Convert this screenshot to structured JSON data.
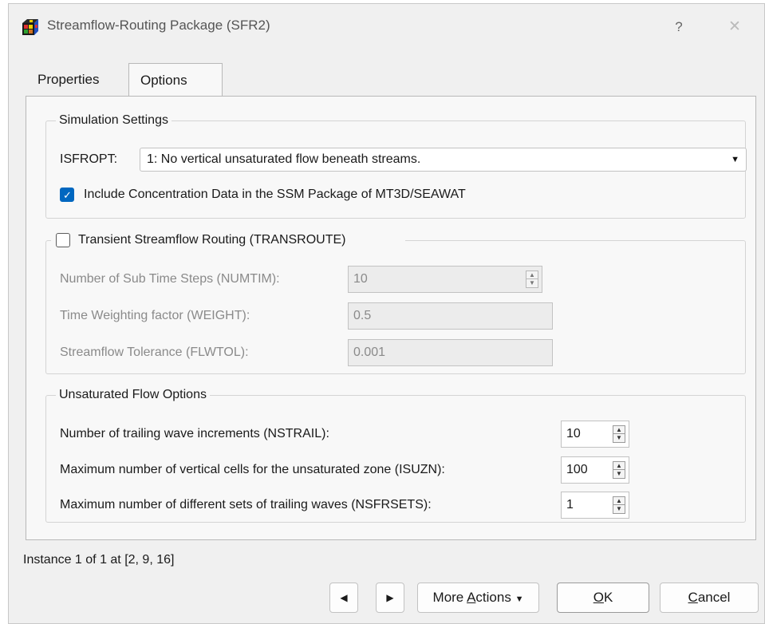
{
  "window": {
    "title": "Streamflow-Routing Package (SFR2)",
    "help_glyph": "?",
    "close_glyph": "✕"
  },
  "tabs": [
    {
      "label": "Properties",
      "active": false
    },
    {
      "label": "Options",
      "active": true
    }
  ],
  "simulation_settings": {
    "title": "Simulation Settings",
    "isfropt_label": "ISFROPT:",
    "isfropt_value": "1: No vertical unsaturated flow beneath streams.",
    "include_concentration": {
      "label": "Include Concentration Data in the SSM Package of MT3D/SEAWAT",
      "checked": true
    }
  },
  "transient": {
    "checkbox_label": "Transient Streamflow Routing (TRANSROUTE)",
    "checked": false,
    "numtim_label": "Number of Sub Time Steps (NUMTIM):",
    "numtim_value": "10",
    "weight_label": "Time Weighting factor (WEIGHT):",
    "weight_value": "0.5",
    "flwtol_label": "Streamflow Tolerance (FLWTOL):",
    "flwtol_value": "0.001"
  },
  "unsaturated": {
    "title": "Unsaturated Flow Options",
    "nstrail_label": "Number of trailing wave increments (NSTRAIL):",
    "nstrail_value": "10",
    "isuzn_label": "Maximum number of vertical cells for the unsaturated zone (ISUZN):",
    "isuzn_value": "100",
    "nsfrsets_label": "Maximum number of different sets of trailing waves (NSFRSETS):",
    "nsfrsets_value": "1"
  },
  "status": "Instance 1 of 1 at [2, 9, 16]",
  "buttons": {
    "more_actions_prefix": "More ",
    "more_actions_accel": "A",
    "more_actions_rest": "ctions",
    "ok_accel": "O",
    "ok_rest": "K",
    "cancel_accel": "C",
    "cancel_rest": "ancel"
  },
  "icons": {
    "app": "sfr-package-icon",
    "prev": "triangle-left-icon",
    "next": "triangle-right-icon",
    "dropdown": "caret-down-icon",
    "spin": "spin-up-down-icon"
  },
  "colors": {
    "accent": "#0067c0",
    "window_bg": "#f0f0f0",
    "panel_bg": "#f8f8f8",
    "disabled_text": "#8a8a8a"
  }
}
